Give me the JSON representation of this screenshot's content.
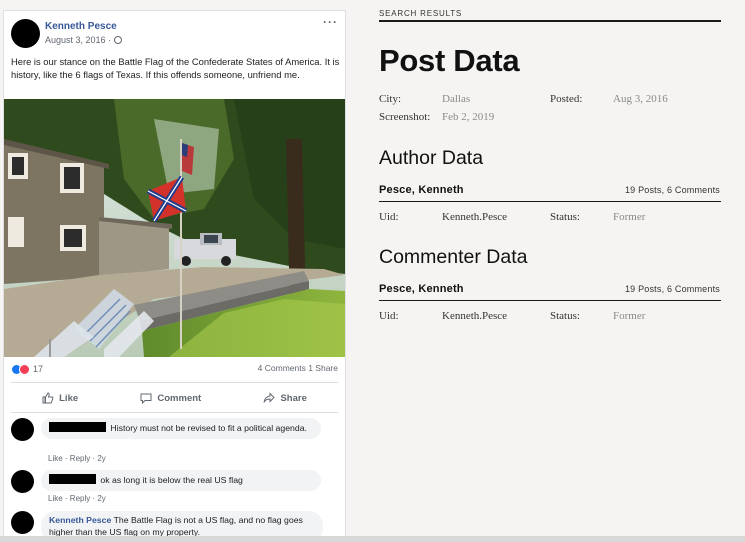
{
  "post": {
    "author": "Kenneth Pesce",
    "date": "August 3, 2016 ·",
    "text": "Here is our stance on the Battle Flag of the Confederate States of America. It is history, like the 6 flags of Texas. If this offends someone, unfriend me.",
    "reaction_count": "17",
    "comments_count": "4 Comments",
    "shares_count": "1 Share",
    "actions": [
      "Like",
      "Comment",
      "Share"
    ]
  },
  "comments": [
    {
      "text": "History must not be revised to fit a political agenda.",
      "actions": "Like · Reply · 2y"
    },
    {
      "text": "ok as long it is below the real US flag",
      "actions": "Like · Reply · 2y"
    },
    {
      "name": "Kenneth Pesce",
      "text": "The Battle Flag is not a US flag, and no flag goes higher than the US flag on my property."
    }
  ],
  "panel": {
    "search_results": "SEARCH RESULTS",
    "title": "Post Data",
    "city_label": "City:",
    "city_value": "Dallas",
    "posted_label": "Posted:",
    "posted_value": "Aug 3, 2016",
    "screenshot_label": "Screenshot:",
    "screenshot_value": "Feb 2, 2019",
    "author_heading": "Author Data",
    "author_name": "Pesce, Kenneth",
    "author_posts": "19 Posts, 6 Comments",
    "uid_label": "Uid:",
    "author_uid": "Kenneth.Pesce",
    "status_label": "Status:",
    "author_status": "Former",
    "commenter_heading": "Commenter Data",
    "commenter_name": "Pesce, Kenneth",
    "commenter_posts": "19 Posts, 6 Comments",
    "commenter_uid": "Kenneth.Pesce",
    "commenter_status": "Former"
  },
  "icons": {
    "more": "more-options-icon",
    "globe": "globe-icon",
    "like": "thumbs-up-icon",
    "comment": "comment-bubble-icon",
    "share": "share-arrow-icon",
    "reaction_like": "like-reaction-icon",
    "reaction_love": "love-reaction-icon"
  },
  "colors": {
    "fb_link": "#385898",
    "fb_text_secondary": "#606770",
    "panel_rule": "#1a1a1a",
    "panel_value_gray": "#8a8a8a"
  }
}
